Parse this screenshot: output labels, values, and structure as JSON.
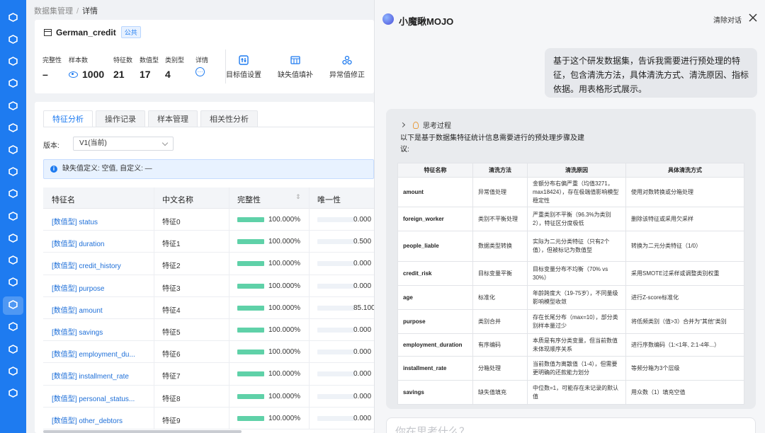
{
  "breadcrumb": {
    "parent": "数据集管理",
    "separator": "/",
    "current": "详情"
  },
  "dataset": {
    "name": "German_credit",
    "tag": "公共",
    "stats": [
      {
        "label": "完整性",
        "value": "–"
      },
      {
        "label": "样本数",
        "value": "1000"
      },
      {
        "label": "特征数",
        "value": "21"
      },
      {
        "label": "数值型",
        "value": "17"
      },
      {
        "label": "类别型",
        "value": "4"
      },
      {
        "label": "详情",
        "value": ""
      }
    ],
    "actions": [
      {
        "label": "目标值设置",
        "icon": "target-setting-icon"
      },
      {
        "label": "缺失值填补",
        "icon": "missing-fill-icon"
      },
      {
        "label": "异常值修正",
        "icon": "outlier-fix-icon"
      }
    ]
  },
  "tabs": [
    "特征分析",
    "操作记录",
    "样本管理",
    "相关性分析"
  ],
  "version": {
    "label": "版本:",
    "selected": "V1(当前)"
  },
  "info": "缺失值定义: 空值, 自定义: —",
  "table": {
    "headers": {
      "name": "特征名",
      "cn": "中文名称",
      "completeness": "完整性",
      "uniqueness": "唯一性"
    },
    "rows": [
      {
        "name": "[数值型] status",
        "cn": "特征0",
        "completeness": "100.000%",
        "completeness_frac": 1.0,
        "uniqueness": "0.000",
        "uniqueness_frac": 0.0
      },
      {
        "name": "[数值型] duration",
        "cn": "特征1",
        "completeness": "100.000%",
        "completeness_frac": 1.0,
        "uniqueness": "0.500",
        "uniqueness_frac": 0.005
      },
      {
        "name": "[数值型] credit_history",
        "cn": "特征2",
        "completeness": "100.000%",
        "completeness_frac": 1.0,
        "uniqueness": "0.000",
        "uniqueness_frac": 0.0
      },
      {
        "name": "[数值型] purpose",
        "cn": "特征3",
        "completeness": "100.000%",
        "completeness_frac": 1.0,
        "uniqueness": "0.000",
        "uniqueness_frac": 0.0
      },
      {
        "name": "[数值型] amount",
        "cn": "特征4",
        "completeness": "100.000%",
        "completeness_frac": 1.0,
        "uniqueness": "85.100",
        "uniqueness_frac": 0.851
      },
      {
        "name": "[数值型] savings",
        "cn": "特征5",
        "completeness": "100.000%",
        "completeness_frac": 1.0,
        "uniqueness": "0.000",
        "uniqueness_frac": 0.0
      },
      {
        "name": "[数值型] employment_du...",
        "cn": "特征6",
        "completeness": "100.000%",
        "completeness_frac": 1.0,
        "uniqueness": "0.000",
        "uniqueness_frac": 0.0
      },
      {
        "name": "[数值型] installment_rate",
        "cn": "特征7",
        "completeness": "100.000%",
        "completeness_frac": 1.0,
        "uniqueness": "0.000",
        "uniqueness_frac": 0.0
      },
      {
        "name": "[数值型] personal_status...",
        "cn": "特征8",
        "completeness": "100.000%",
        "completeness_frac": 1.0,
        "uniqueness": "0.000",
        "uniqueness_frac": 0.0
      },
      {
        "name": "[数值型] other_debtors",
        "cn": "特征9",
        "completeness": "100.000%",
        "completeness_frac": 1.0,
        "uniqueness": "0.000",
        "uniqueness_frac": 0.0
      }
    ]
  },
  "chat": {
    "title": "小魔瞅MOJO",
    "clear": "清除对话",
    "user_message": "基于这个研发数据集，告诉我需要进行预处理的特征，包含清洗方法，具体清洗方式、清洗原因、指标依据。用表格形式展示。",
    "thinking": "思考过程",
    "answer_intro": "以下是基于数据集特征统计信息需要进行的预处理步骤及建议:",
    "answer_headers": [
      "特征名称",
      "清洗方法",
      "清洗原因",
      "具体清洗方式"
    ],
    "answer_rows": [
      [
        "amount",
        "异常值处理",
        "金额分布右偏严重（均值3271，max18424），存在极端值影响模型稳定性",
        "使用对数转换或分箱处理"
      ],
      [
        "foreign_worker",
        "类别不平衡处理",
        "严重类别不平衡（96.3%为类别2），特征区分度极低",
        "删除该特征或采用欠采样"
      ],
      [
        "people_liable",
        "数据类型转换",
        "实际为二元分类特征（只有2个值），但被标记为数值型",
        "转换为二元分类特征（1/0）"
      ],
      [
        "credit_risk",
        "目标变量平衡",
        "目标变量分布不均衡（70% vs 30%）",
        "采用SMOTE过采样或调整类别权重"
      ],
      [
        "age",
        "标准化",
        "年龄跨度大（19-75岁），不同量级影响模型收敛",
        "进行Z-score标准化"
      ],
      [
        "purpose",
        "类别合并",
        "存在长尾分布（max=10），部分类别样本量过少",
        "将低频类别（值>3）合并为\"其他\"类别"
      ],
      [
        "employment_duration",
        "有序编码",
        "本质是有序分类变量，但当前数值未体现顺序关系",
        "进行序数编码（1:<1年, 2:1-4年...）"
      ],
      [
        "installment_rate",
        "分箱处理",
        "当前数值为离散值（1-4），但需要更明确的还款能力划分",
        "等频分箱为3个层级"
      ],
      [
        "savings",
        "缺失值填充",
        "中位数=1，可能存在未记录的默认值",
        "用众数（1）填充空值"
      ]
    ],
    "input_placeholder": "你在思考什么？"
  },
  "colors": {
    "accent": "#1e7bf0",
    "rail": "#1e7bf0",
    "complete_bar": "#5fd1a8",
    "unique_bar": "#7fb1f5"
  }
}
